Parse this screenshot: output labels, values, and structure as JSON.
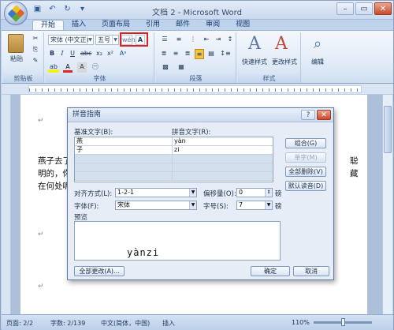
{
  "app": {
    "title": "文档 2 - Microsoft Word"
  },
  "tabs": [
    "开始",
    "插入",
    "页面布局",
    "引用",
    "邮件",
    "审阅",
    "视图"
  ],
  "ribbon": {
    "paste_label": "粘贴",
    "clipboard_group": "剪贴板",
    "font_group": "字体",
    "paragraph_group": "段落",
    "styles_group": "样式",
    "font_name": "宋体 (中文正)",
    "font_size": "五号",
    "quick_styles": "快速样式",
    "change_styles": "更改样式",
    "editing": "编辑"
  },
  "document": {
    "lines": [
      "燕子去了，",
      "明的，你告",
      "在何处呢？"
    ],
    "right_chars": [
      "聪",
      "藏"
    ]
  },
  "statusbar": {
    "page": "页面: 2/2",
    "words": "字数: 2/139",
    "language": "中文(简体，中国)",
    "mode": "插入",
    "zoom": "110%"
  },
  "dialog": {
    "title": "拼音指南",
    "base_text_label": "基准文字(B):",
    "ruby_text_label": "拼音文字(R):",
    "rows": [
      {
        "base": "燕",
        "ruby": "yàn"
      },
      {
        "base": "子",
        "ruby": "zi"
      }
    ],
    "buttons": {
      "group": "组合(G)",
      "mono": "单字(M)",
      "clear_all": "全部删除(V)",
      "default": "默认读音(D)",
      "change_all": "全部更改(A)...",
      "ok": "确定",
      "cancel": "取消"
    },
    "alignment_label": "对齐方式(L):",
    "alignment_value": "1-2-1",
    "offset_label": "偏移量(O):",
    "offset_value": "0",
    "offset_unit": "磅",
    "font_label": "字体(F):",
    "font_value": "宋体",
    "size_label": "字号(S):",
    "size_value": "7",
    "size_unit": "磅",
    "preview_label": "预览",
    "preview_text": "yànzi"
  }
}
